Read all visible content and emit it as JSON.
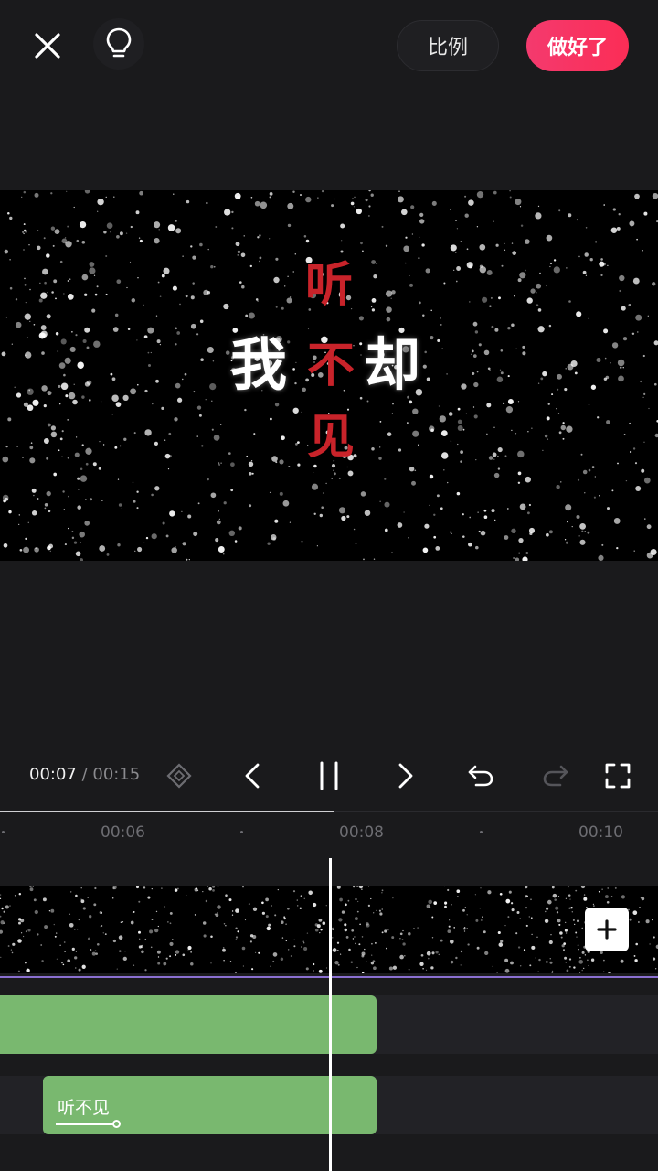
{
  "topbar": {
    "close_icon": "close-icon",
    "bulb_icon": "lightbulb-icon",
    "ratio_label": "比例",
    "done_label": "做好了",
    "done_color": "#f43a6e"
  },
  "preview": {
    "caption_left": "我",
    "caption_right": "却",
    "caption_vertical": [
      "听",
      "不",
      "见"
    ],
    "caption_red": "#c8232a"
  },
  "controls": {
    "current_time": "00:07",
    "separator": " / ",
    "total_time": "00:15",
    "icons": [
      "keyframe-icon",
      "prev-frame-icon",
      "pause-icon",
      "next-frame-icon",
      "undo-icon",
      "redo-icon",
      "fullscreen-icon"
    ]
  },
  "ruler": {
    "labels": [
      "00:06",
      "00:08",
      "00:10"
    ]
  },
  "timeline": {
    "text_clip_label": "听不见",
    "add_icon": "plus-icon",
    "clip_color": "#79b86f",
    "track_accent": "#8a6fd0"
  }
}
